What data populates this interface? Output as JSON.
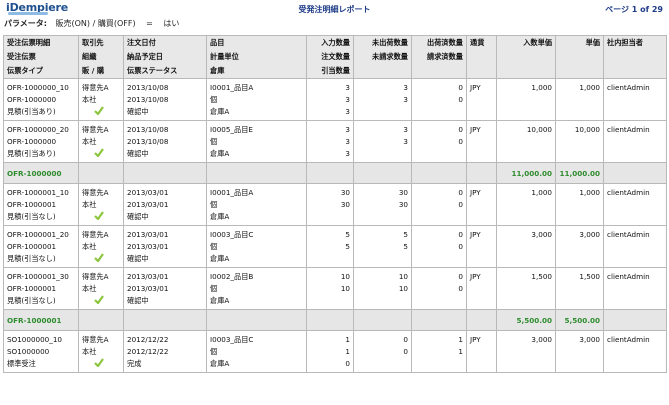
{
  "app": {
    "logo": "iDempiere"
  },
  "report": {
    "title": "受発注明細レポート",
    "page": "ページ 1 of 29"
  },
  "params": {
    "label": "パラメータ:",
    "name": "販売(ON) / 購買(OFF)",
    "eq": "=",
    "value": "はい"
  },
  "headers": {
    "c1": [
      "受注伝票明細",
      "受注伝票",
      "伝票タイプ"
    ],
    "c2": [
      "取引先",
      "組織",
      "販 / 購"
    ],
    "c3": [
      "注文日付",
      "納品予定日",
      "伝票ステータス"
    ],
    "c4": [
      "品目",
      "計量単位",
      "倉庫"
    ],
    "c5": [
      "入力数量",
      "注文数量",
      "引当数量"
    ],
    "c6": [
      "未出荷数量",
      "未請求数量"
    ],
    "c7": [
      "出荷済数量",
      "請求済数量"
    ],
    "c8": [
      "通貨"
    ],
    "c9": [
      "入数単価"
    ],
    "c10": [
      "単価"
    ],
    "c11": [
      "社内担当者"
    ]
  },
  "rows": [
    {
      "kind": "item",
      "c1": [
        "OFR-1000000_10",
        "OFR-1000000",
        "見積(引当あり)"
      ],
      "c2": [
        "得意先A",
        "本社"
      ],
      "c3": [
        "2013/10/08",
        "2013/10/08",
        "確認中"
      ],
      "c4": [
        "I0001_品目A",
        "個",
        "倉庫A"
      ],
      "c5": [
        "3",
        "3",
        "3"
      ],
      "c6": [
        "3",
        "3"
      ],
      "c7": [
        "0",
        "0"
      ],
      "currency": "JPY",
      "price_list": "1,000",
      "price": "1,000",
      "rep": "clientAdmin"
    },
    {
      "kind": "item",
      "c1": [
        "OFR-1000000_20",
        "OFR-1000000",
        "見積(引当あり)"
      ],
      "c2": [
        "得意先A",
        "本社"
      ],
      "c3": [
        "2013/10/08",
        "2013/10/08",
        "確認中"
      ],
      "c4": [
        "I0005_品目E",
        "個",
        "倉庫A"
      ],
      "c5": [
        "3",
        "3",
        "3"
      ],
      "c6": [
        "3",
        "3"
      ],
      "c7": [
        "0",
        "0"
      ],
      "currency": "JPY",
      "price_list": "10,000",
      "price": "10,000",
      "rep": "clientAdmin"
    },
    {
      "kind": "sum",
      "label": "OFR-1000000",
      "v1": "11,000.00",
      "v2": "11,000.00"
    },
    {
      "kind": "item",
      "c1": [
        "OFR-1000001_10",
        "OFR-1000001",
        "見積(引当なし)"
      ],
      "c2": [
        "得意先A",
        "本社"
      ],
      "c3": [
        "2013/03/01",
        "2013/03/01",
        "確認中"
      ],
      "c4": [
        "I0001_品目A",
        "個",
        "倉庫A"
      ],
      "c5": [
        "30",
        "30",
        ""
      ],
      "c6": [
        "30",
        "30"
      ],
      "c7": [
        "0",
        "0"
      ],
      "currency": "JPY",
      "price_list": "1,000",
      "price": "1,000",
      "rep": "clientAdmin"
    },
    {
      "kind": "item",
      "c1": [
        "OFR-1000001_20",
        "OFR-1000001",
        "見積(引当なし)"
      ],
      "c2": [
        "得意先A",
        "本社"
      ],
      "c3": [
        "2013/03/01",
        "2013/03/01",
        "確認中"
      ],
      "c4": [
        "I0003_品目C",
        "個",
        "倉庫A"
      ],
      "c5": [
        "5",
        "5",
        ""
      ],
      "c6": [
        "5",
        "5"
      ],
      "c7": [
        "0",
        "0"
      ],
      "currency": "JPY",
      "price_list": "3,000",
      "price": "3,000",
      "rep": "clientAdmin"
    },
    {
      "kind": "item",
      "c1": [
        "OFR-1000001_30",
        "OFR-1000001",
        "見積(引当なし)"
      ],
      "c2": [
        "得意先A",
        "本社"
      ],
      "c3": [
        "2013/03/01",
        "2013/03/01",
        "確認中"
      ],
      "c4": [
        "I0002_品目B",
        "個",
        "倉庫A"
      ],
      "c5": [
        "10",
        "10",
        ""
      ],
      "c6": [
        "10",
        "10"
      ],
      "c7": [
        "0",
        "0"
      ],
      "currency": "JPY",
      "price_list": "1,500",
      "price": "1,500",
      "rep": "clientAdmin"
    },
    {
      "kind": "sum",
      "label": "OFR-1000001",
      "v1": "5,500.00",
      "v2": "5,500.00"
    },
    {
      "kind": "item",
      "c1": [
        "SO1000000_10",
        "SO1000000",
        "標準受注"
      ],
      "c2": [
        "得意先A",
        "本社"
      ],
      "c3": [
        "2012/12/22",
        "2012/12/22",
        "完成"
      ],
      "c4": [
        "I0003_品目C",
        "個",
        "倉庫A"
      ],
      "c5": [
        "1",
        "1",
        "0"
      ],
      "c6": [
        "0",
        "0"
      ],
      "c7": [
        "1",
        "1"
      ],
      "currency": "JPY",
      "price_list": "3,000",
      "price": "3,000",
      "rep": "clientAdmin"
    }
  ],
  "colors": {
    "title": "#1f3c88",
    "subtotal_text": "#2f8c2f",
    "check": "#8cc63e",
    "header_bg": "#e8e8e8",
    "subtotal_bg": "#e6e6e6"
  },
  "icons": {
    "check": "checkmark-icon"
  }
}
